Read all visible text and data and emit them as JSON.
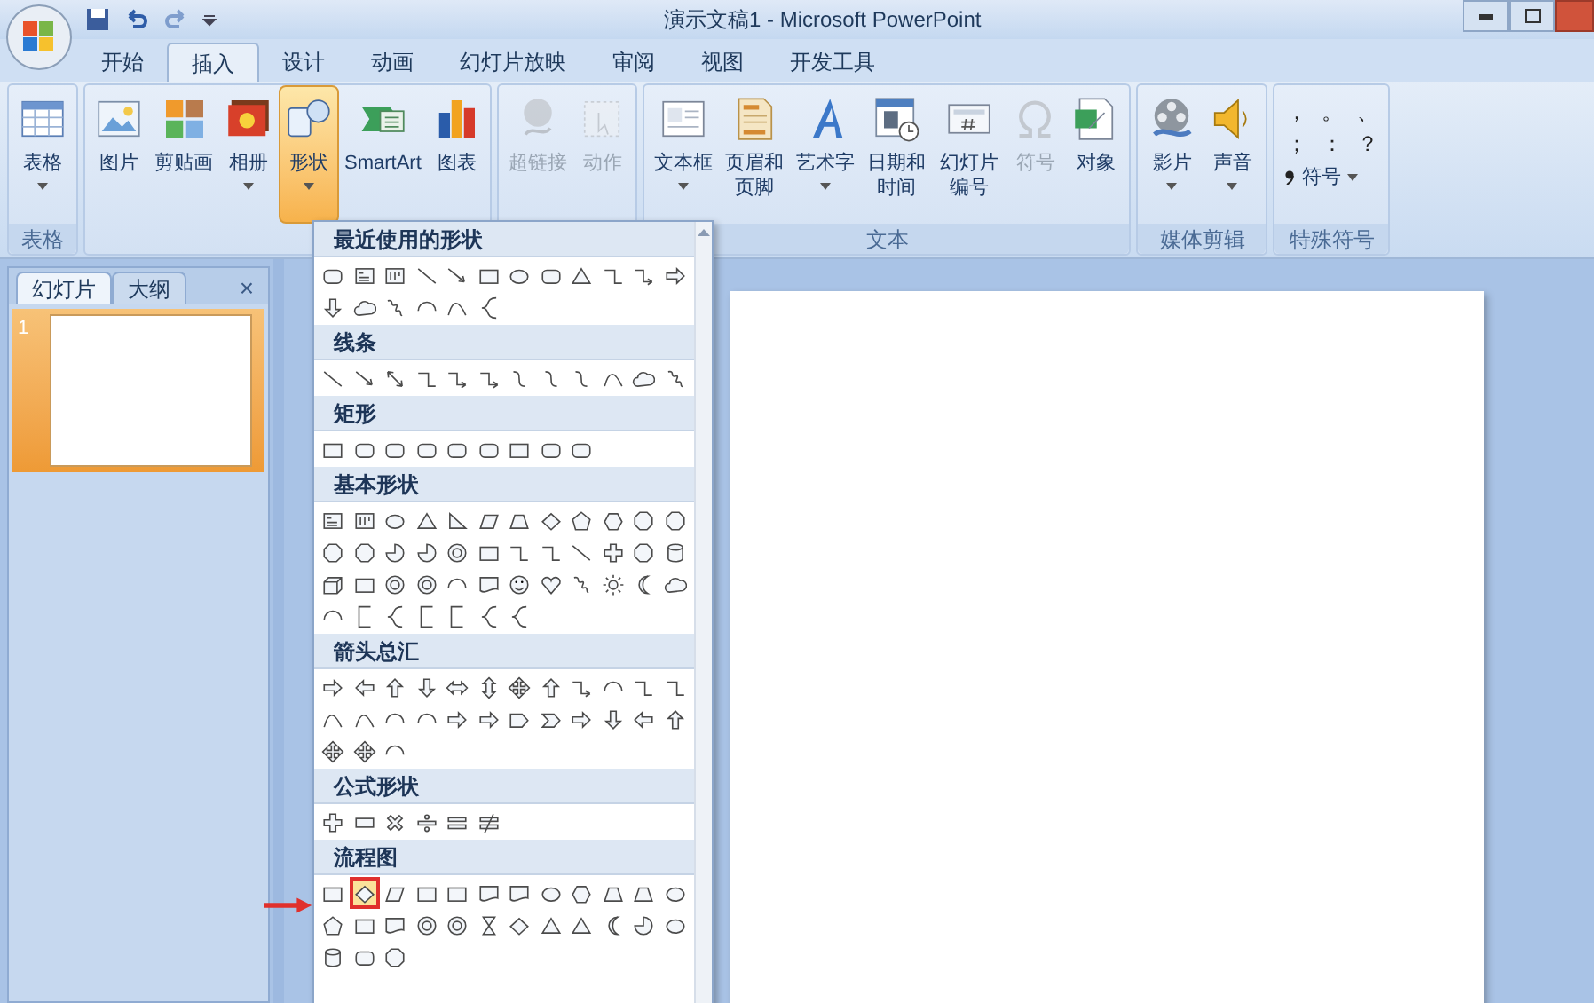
{
  "window": {
    "title": "演示文稿1 - Microsoft PowerPoint"
  },
  "tabs": [
    {
      "label": "开始",
      "selected": false
    },
    {
      "label": "插入",
      "selected": true
    },
    {
      "label": "设计",
      "selected": false
    },
    {
      "label": "动画",
      "selected": false
    },
    {
      "label": "幻灯片放映",
      "selected": false
    },
    {
      "label": "审阅",
      "selected": false
    },
    {
      "label": "视图",
      "selected": false
    },
    {
      "label": "开发工具",
      "selected": false
    }
  ],
  "ribbon": {
    "groups": [
      {
        "label": "表格",
        "buttons": [
          {
            "label": "表格",
            "kind": "table",
            "dropdown": true,
            "disabled": false,
            "active": false
          }
        ]
      },
      {
        "buttons": [
          {
            "label": "图片",
            "kind": "picture",
            "dropdown": false,
            "disabled": false,
            "active": false
          },
          {
            "label": "剪贴画",
            "kind": "clipart",
            "dropdown": false,
            "disabled": false,
            "active": false
          },
          {
            "label": "相册",
            "kind": "album",
            "dropdown": true,
            "disabled": false,
            "active": false
          },
          {
            "label": "形状",
            "kind": "shapes",
            "dropdown": true,
            "disabled": false,
            "active": true
          },
          {
            "label": "SmartArt",
            "kind": "smartart",
            "dropdown": false,
            "disabled": false,
            "active": false
          },
          {
            "label": "图表",
            "kind": "chart",
            "dropdown": false,
            "disabled": false,
            "active": false
          }
        ]
      },
      {
        "buttons": [
          {
            "label": "超链接",
            "kind": "hyperlink",
            "dropdown": false,
            "disabled": true,
            "active": false
          },
          {
            "label": "动作",
            "kind": "action",
            "dropdown": false,
            "disabled": true,
            "active": false
          }
        ]
      },
      {
        "label": "文本",
        "buttons": [
          {
            "label": "文本框",
            "kind": "textbox",
            "dropdown": true,
            "disabled": false,
            "active": false
          },
          {
            "label": "页眉和页脚",
            "kind": "header",
            "dropdown": false,
            "disabled": false,
            "active": false
          },
          {
            "label": "艺术字",
            "kind": "wordart",
            "dropdown": true,
            "disabled": false,
            "active": false
          },
          {
            "label": "日期和时间",
            "kind": "datetime",
            "dropdown": false,
            "disabled": false,
            "active": false
          },
          {
            "label": "幻灯片编号",
            "kind": "slidenumber",
            "dropdown": false,
            "disabled": false,
            "active": false
          },
          {
            "label": "符号",
            "kind": "omega",
            "dropdown": false,
            "disabled": true,
            "active": false
          },
          {
            "label": "对象",
            "kind": "object",
            "dropdown": false,
            "disabled": false,
            "active": false
          }
        ]
      },
      {
        "label": "媒体剪辑",
        "buttons": [
          {
            "label": "影片",
            "kind": "movie",
            "dropdown": true,
            "disabled": false,
            "active": false
          },
          {
            "label": "声音",
            "kind": "sound",
            "dropdown": true,
            "disabled": false,
            "active": false
          }
        ]
      },
      {
        "label": "特殊符号",
        "symbols": [
          "，",
          "。",
          "、",
          "；",
          "：",
          "？"
        ],
        "symbol_button": {
          "label": "符号",
          "dropdown": true
        }
      }
    ]
  },
  "slide_panel": {
    "tabs": [
      {
        "label": "幻灯片",
        "selected": true
      },
      {
        "label": "大纲",
        "selected": false
      }
    ],
    "close": "×",
    "slides": [
      {
        "number": "1",
        "selected": true
      }
    ]
  },
  "shapes_menu": {
    "sections": [
      {
        "label": "最近使用的形状",
        "shapes": [
          {
            "kind": "rounded-rectangle",
            "selected": false
          },
          {
            "kind": "text-box",
            "selected": false
          },
          {
            "kind": "vertical-text-box",
            "selected": false
          },
          {
            "kind": "line",
            "selected": false
          },
          {
            "kind": "arrow-line",
            "selected": false
          },
          {
            "kind": "rectangle",
            "selected": false
          },
          {
            "kind": "oval",
            "selected": false
          },
          {
            "kind": "rounded-rectangle",
            "selected": false
          },
          {
            "kind": "triangle",
            "selected": false
          },
          {
            "kind": "elbow",
            "selected": false
          },
          {
            "kind": "elbow-arrow",
            "selected": false
          },
          {
            "kind": "right-arrow",
            "selected": false
          },
          {
            "kind": "down-arrow",
            "selected": false
          },
          {
            "kind": "cloud",
            "selected": false
          },
          {
            "kind": "scribble",
            "selected": false
          },
          {
            "kind": "arc",
            "selected": false
          },
          {
            "kind": "curve",
            "selected": false
          },
          {
            "kind": "brace",
            "selected": false
          }
        ]
      },
      {
        "label": "线条",
        "shapes": [
          {
            "kind": "line",
            "selected": false
          },
          {
            "kind": "arrow-line",
            "selected": false
          },
          {
            "kind": "double-arrow-line",
            "selected": false
          },
          {
            "kind": "elbow",
            "selected": false
          },
          {
            "kind": "elbow-arrow",
            "selected": false
          },
          {
            "kind": "elbow-arrow",
            "selected": false
          },
          {
            "kind": "s-curve",
            "selected": false
          },
          {
            "kind": "s-curve",
            "selected": false
          },
          {
            "kind": "s-curve",
            "selected": false
          },
          {
            "kind": "curve",
            "selected": false
          },
          {
            "kind": "cloud",
            "selected": false
          },
          {
            "kind": "scribble",
            "selected": false
          }
        ]
      },
      {
        "label": "矩形",
        "shapes": [
          {
            "kind": "rectangle",
            "selected": false
          },
          {
            "kind": "rounded-rectangle",
            "selected": false
          },
          {
            "kind": "rounded-rectangle",
            "selected": false
          },
          {
            "kind": "rounded-rectangle",
            "selected": false
          },
          {
            "kind": "rounded-rectangle",
            "selected": false
          },
          {
            "kind": "rounded-rectangle",
            "selected": false
          },
          {
            "kind": "rectangle",
            "selected": false
          },
          {
            "kind": "rounded-rectangle",
            "selected": false
          },
          {
            "kind": "rounded-rectangle",
            "selected": false
          }
        ]
      },
      {
        "label": "基本形状",
        "shapes": [
          {
            "kind": "text-box",
            "selected": false
          },
          {
            "kind": "vertical-text-box",
            "selected": false
          },
          {
            "kind": "oval",
            "selected": false
          },
          {
            "kind": "triangle",
            "selected": false
          },
          {
            "kind": "right-triangle",
            "selected": false
          },
          {
            "kind": "parallelogram",
            "selected": false
          },
          {
            "kind": "trapezoid",
            "selected": false
          },
          {
            "kind": "diamond",
            "selected": false
          },
          {
            "kind": "pentagon",
            "selected": false
          },
          {
            "kind": "hexagon",
            "selected": false
          },
          {
            "kind": "octagon",
            "selected": false
          },
          {
            "kind": "octagon",
            "selected": false
          },
          {
            "kind": "octagon",
            "selected": false
          },
          {
            "kind": "octagon",
            "selected": false
          },
          {
            "kind": "pie",
            "selected": false
          },
          {
            "kind": "pie",
            "selected": false
          },
          {
            "kind": "donut",
            "selected": false
          },
          {
            "kind": "rectangle",
            "selected": false
          },
          {
            "kind": "elbow",
            "selected": false
          },
          {
            "kind": "elbow",
            "selected": false
          },
          {
            "kind": "line",
            "selected": false
          },
          {
            "kind": "plus",
            "selected": false
          },
          {
            "kind": "octagon",
            "selected": false
          },
          {
            "kind": "cylinder",
            "selected": false
          },
          {
            "kind": "cube",
            "selected": false
          },
          {
            "kind": "rectangle",
            "selected": false
          },
          {
            "kind": "donut",
            "selected": false
          },
          {
            "kind": "donut",
            "selected": false
          },
          {
            "kind": "arc",
            "selected": false
          },
          {
            "kind": "document",
            "selected": false
          },
          {
            "kind": "smiley",
            "selected": false
          },
          {
            "kind": "heart",
            "selected": false
          },
          {
            "kind": "scribble",
            "selected": false
          },
          {
            "kind": "sun",
            "selected": false
          },
          {
            "kind": "moon",
            "selected": false
          },
          {
            "kind": "cloud",
            "selected": false
          },
          {
            "kind": "arc",
            "selected": false
          },
          {
            "kind": "bracket",
            "selected": false
          },
          {
            "kind": "brace",
            "selected": false
          },
          {
            "kind": "bracket",
            "selected": false
          },
          {
            "kind": "bracket",
            "selected": false
          },
          {
            "kind": "brace",
            "selected": false
          },
          {
            "kind": "brace",
            "selected": false
          }
        ]
      },
      {
        "label": "箭头总汇",
        "shapes": [
          {
            "kind": "right-arrow",
            "selected": false
          },
          {
            "kind": "left-arrow",
            "selected": false
          },
          {
            "kind": "up-arrow",
            "selected": false
          },
          {
            "kind": "down-arrow",
            "selected": false
          },
          {
            "kind": "left-right-arrow",
            "selected": false
          },
          {
            "kind": "up-down-arrow",
            "selected": false
          },
          {
            "kind": "quad-arrow",
            "selected": false
          },
          {
            "kind": "up-arrow",
            "selected": false
          },
          {
            "kind": "elbow-arrow",
            "selected": false
          },
          {
            "kind": "arc",
            "selected": false
          },
          {
            "kind": "elbow",
            "selected": false
          },
          {
            "kind": "elbow",
            "selected": false
          },
          {
            "kind": "curve",
            "selected": false
          },
          {
            "kind": "curve",
            "selected": false
          },
          {
            "kind": "arc",
            "selected": false
          },
          {
            "kind": "arc",
            "selected": false
          },
          {
            "kind": "right-arrow",
            "selected": false
          },
          {
            "kind": "right-arrow",
            "selected": false
          },
          {
            "kind": "pentagon-arrow",
            "selected": false
          },
          {
            "kind": "chevron",
            "selected": false
          },
          {
            "kind": "right-arrow",
            "selected": false
          },
          {
            "kind": "down-arrow",
            "selected": false
          },
          {
            "kind": "left-arrow",
            "selected": false
          },
          {
            "kind": "up-arrow",
            "selected": false
          },
          {
            "kind": "quad-arrow",
            "selected": false
          },
          {
            "kind": "quad-arrow",
            "selected": false
          },
          {
            "kind": "arc",
            "selected": false
          }
        ]
      },
      {
        "label": "公式形状",
        "shapes": [
          {
            "kind": "plus",
            "selected": false
          },
          {
            "kind": "minus",
            "selected": false
          },
          {
            "kind": "times",
            "selected": false
          },
          {
            "kind": "divide",
            "selected": false
          },
          {
            "kind": "equal",
            "selected": false
          },
          {
            "kind": "not-equal",
            "selected": false
          }
        ]
      },
      {
        "label": "流程图",
        "shapes": [
          {
            "kind": "rectangle",
            "selected": false
          },
          {
            "kind": "diamond",
            "selected": true
          },
          {
            "kind": "parallelogram",
            "selected": false
          },
          {
            "kind": "rectangle",
            "selected": false
          },
          {
            "kind": "rectangle",
            "selected": false
          },
          {
            "kind": "document",
            "selected": false
          },
          {
            "kind": "document",
            "selected": false
          },
          {
            "kind": "oval",
            "selected": false
          },
          {
            "kind": "hexagon",
            "selected": false
          },
          {
            "kind": "trapezoid",
            "selected": false
          },
          {
            "kind": "trapezoid",
            "selected": false
          },
          {
            "kind": "oval",
            "selected": false
          },
          {
            "kind": "pentagon",
            "selected": false
          },
          {
            "kind": "rectangle",
            "selected": false
          },
          {
            "kind": "document",
            "selected": false
          },
          {
            "kind": "donut",
            "selected": false
          },
          {
            "kind": "donut",
            "selected": false
          },
          {
            "kind": "hourglass",
            "selected": false
          },
          {
            "kind": "diamond",
            "selected": false
          },
          {
            "kind": "triangle",
            "selected": false
          },
          {
            "kind": "triangle",
            "selected": false
          },
          {
            "kind": "moon",
            "selected": false
          },
          {
            "kind": "pie",
            "selected": false
          },
          {
            "kind": "oval",
            "selected": false
          },
          {
            "kind": "cylinder",
            "selected": false
          },
          {
            "kind": "rounded-rectangle",
            "selected": false
          },
          {
            "kind": "octagon",
            "selected": false
          }
        ]
      }
    ]
  }
}
